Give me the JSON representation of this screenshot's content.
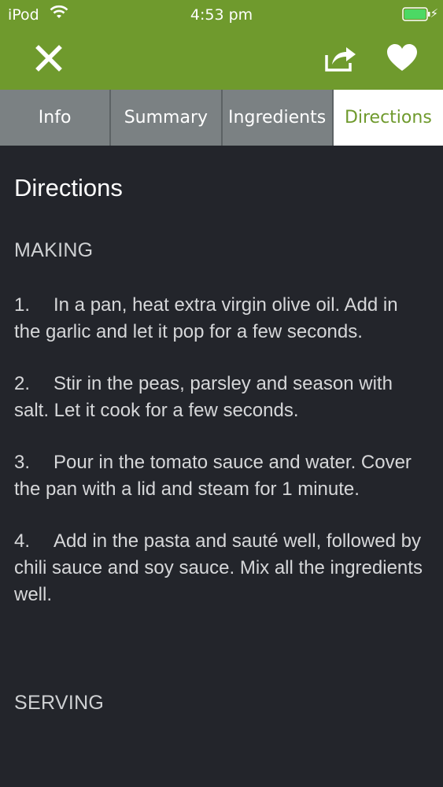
{
  "status_bar": {
    "carrier": "iPod",
    "time": "4:53 pm"
  },
  "nav": {
    "close_icon": "close-icon",
    "share_icon": "share-icon",
    "favorite_icon": "heart-icon"
  },
  "tabs": [
    {
      "label": "Info"
    },
    {
      "label": "Summary"
    },
    {
      "label": "Ingredients"
    },
    {
      "label": "Directions"
    }
  ],
  "content": {
    "title": "Directions",
    "making_heading": "MAKING",
    "steps": [
      {
        "num": "1.",
        "text": "In a pan, heat extra virgin olive oil. Add in the garlic and let it pop for a few seconds."
      },
      {
        "num": "2.",
        "text": "Stir in the peas, parsley and season with salt. Let it cook for a few seconds."
      },
      {
        "num": "3.",
        "text": "Pour in the tomato sauce and water. Cover the pan with a lid and steam for 1 minute."
      },
      {
        "num": "4.",
        "text": "Add in the pasta and sauté well, followed by chili sauce and soy sauce. Mix all the ingredients well."
      }
    ],
    "serving_heading": "SERVING"
  },
  "colors": {
    "accent": "#6f9a2d",
    "background": "#23252b",
    "tab_inactive": "#7b8183"
  }
}
